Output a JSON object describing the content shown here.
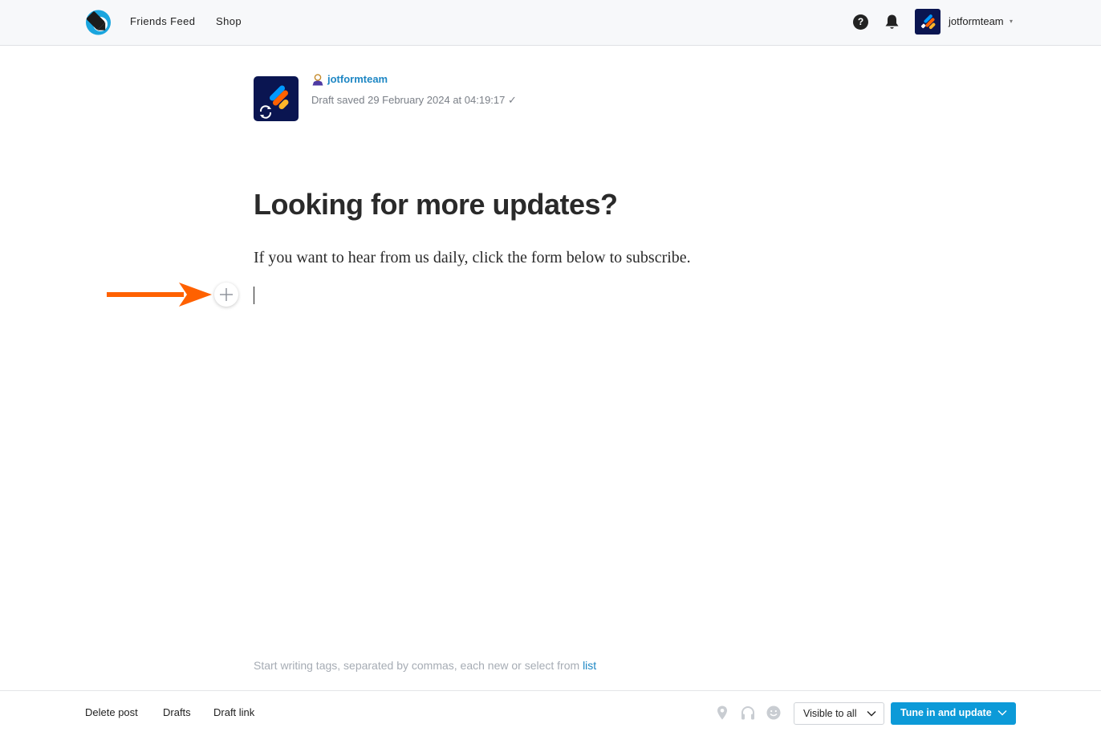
{
  "nav": {
    "friends_feed": "Friends Feed",
    "shop": "Shop",
    "help_glyph": "?",
    "username": "jotformteam",
    "caret": "▾"
  },
  "post": {
    "author": "jotformteam",
    "draft_status": "Draft saved 29 February 2024 at 04:19:17 ✓",
    "title": "Looking for more updates?",
    "body": "If you want to hear from us daily, click the form below to subscribe."
  },
  "tags": {
    "hint": "Start writing tags, separated by commas, each new or select from ",
    "list_link": "list"
  },
  "footer": {
    "delete_post": "Delete post",
    "drafts": "Drafts",
    "draft_link": "Draft link",
    "visibility": "Visible to all",
    "publish": "Tune in and update"
  },
  "icons": {
    "logo": "pen-logo-icon",
    "help": "help-icon",
    "notifications": "bell-icon",
    "location": "location-pin-icon",
    "audio": "headphones-icon",
    "emoji": "smiley-icon",
    "add_block": "plus-icon",
    "annotation": "orange-arrow-icon"
  },
  "colors": {
    "accent": "#0c9ad8",
    "link": "#1e87c4",
    "annotation_arrow": "#ff6100",
    "avatar_bg": "#0a1551"
  }
}
